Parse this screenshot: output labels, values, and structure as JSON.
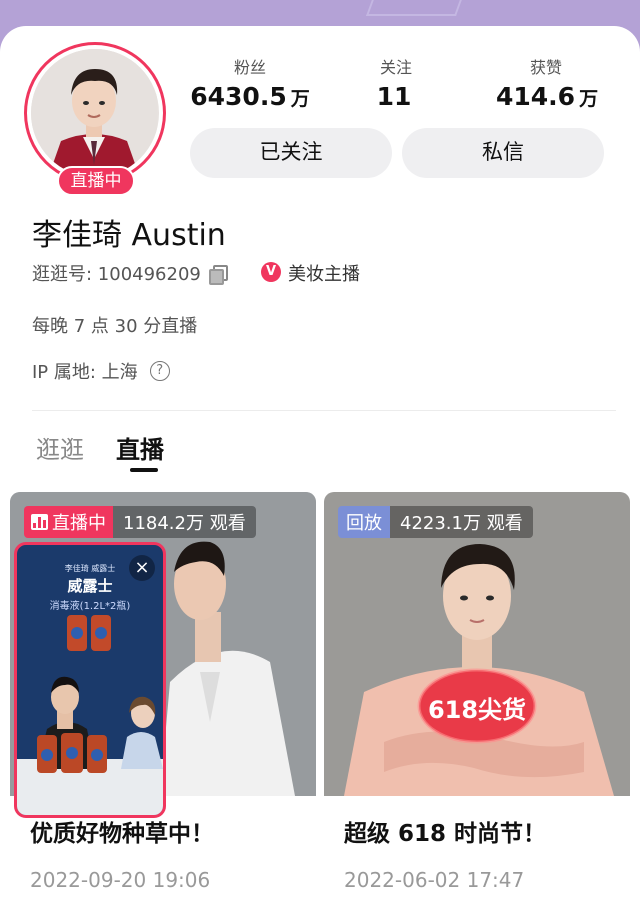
{
  "profile": {
    "name": "李佳琦 Austin",
    "id_label": "逛逛号: 100496209",
    "tag": "美妆主播",
    "schedule": "每晚 7 点 30 分直播",
    "ip": "IP 属地: 上海",
    "live_badge": "直播中",
    "verified_icon": "V"
  },
  "stats": [
    {
      "label": "粉丝",
      "value": "6430.5",
      "unit": "万"
    },
    {
      "label": "关注",
      "value": "11",
      "unit": ""
    },
    {
      "label": "获赞",
      "value": "414.6",
      "unit": "万"
    }
  ],
  "buttons": {
    "follow": "已关注",
    "message": "私信"
  },
  "tabs": [
    {
      "label": "逛逛",
      "active": false
    },
    {
      "label": "直播",
      "active": true
    }
  ],
  "cards": [
    {
      "badge": "直播中",
      "count": "1184.2万 观看",
      "title": "优质好物种草中！",
      "date": "2022-09-20 19:06"
    },
    {
      "badge": "回放",
      "count": "4223.1万 观看",
      "title": "超级 618 时尚节！",
      "date": "2022-06-02 17:47"
    }
  ],
  "pip": {
    "brand": "李佳琦 威露士",
    "product": "威露士",
    "spec": "消毒液(1.2L*2瓶)",
    "close": "×"
  },
  "promo": {
    "text": "618尖货"
  },
  "colors": {
    "accent": "#f0365e",
    "replay": "#7b8fd6",
    "header_bg": "#b4a2d6"
  }
}
